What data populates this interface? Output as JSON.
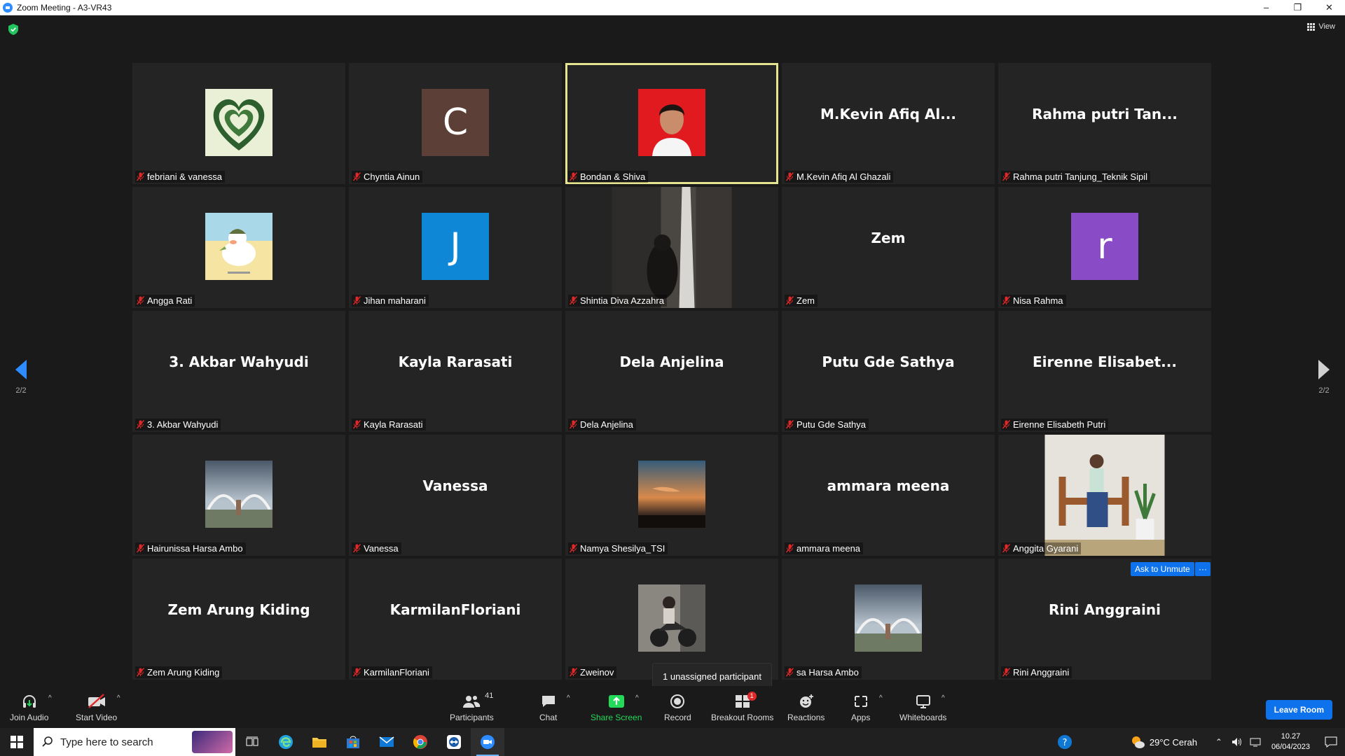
{
  "window": {
    "title": "Zoom Meeting - A3-VR43",
    "minimize": "–",
    "restore": "❐",
    "close": "✕"
  },
  "view_label": "View",
  "pagination": {
    "left": "2/2",
    "right": "2/2"
  },
  "tiles": [
    {
      "name": "febriani & vanessa",
      "kind": "image",
      "image": "green-heart"
    },
    {
      "name": "Chyntia Ainun",
      "kind": "letter",
      "letter": "C",
      "color": "#5c3f36"
    },
    {
      "name": "Bondan & Shiva",
      "kind": "image",
      "image": "portrait-red",
      "active": true
    },
    {
      "name": "M.Kevin Afiq Al Ghazali",
      "kind": "text",
      "display": "M.Kevin  Afiq  Al..."
    },
    {
      "name": "Rahma putri Tanjung_Teknik Sipil",
      "kind": "text",
      "display": "Rahma  putri  Tan..."
    },
    {
      "name": "Angga Rati",
      "kind": "image",
      "image": "duck-sticker"
    },
    {
      "name": "Jihan maharani",
      "kind": "letter",
      "letter": "J",
      "color": "#0e87d6"
    },
    {
      "name": "Shintia Diva Azzahra",
      "kind": "photo-tall",
      "image": "waterfall"
    },
    {
      "name": "Zem",
      "kind": "text",
      "display": "Zem"
    },
    {
      "name": "Nisa Rahma",
      "kind": "letter",
      "letter": "r",
      "color": "#8a4bc7"
    },
    {
      "name": "3. Akbar Wahyudi",
      "kind": "text",
      "display": "3. Akbar Wahyudi"
    },
    {
      "name": "Kayla Rarasati",
      "kind": "text",
      "display": "Kayla Rarasati"
    },
    {
      "name": "Dela Anjelina",
      "kind": "text",
      "display": "Dela Anjelina"
    },
    {
      "name": "Putu Gde Sathya",
      "kind": "text",
      "display": "Putu Gde Sathya"
    },
    {
      "name": "Eirenne Elisabeth Putri",
      "kind": "text",
      "display": "Eirenne  Elisabet..."
    },
    {
      "name": "Hairunissa Harsa Ambo",
      "kind": "image",
      "image": "sky-arches"
    },
    {
      "name": "Vanessa",
      "kind": "text",
      "display": "Vanessa"
    },
    {
      "name": "Namya Shesilya_TSI",
      "kind": "image",
      "image": "sunset"
    },
    {
      "name": "ammara meena",
      "kind": "text",
      "display": "ammara meena"
    },
    {
      "name": "Anggita Gyarani",
      "kind": "photo-tall",
      "image": "bench-portrait"
    },
    {
      "name": "Zem Arung Kiding",
      "kind": "text",
      "display": "Zem Arung Kiding"
    },
    {
      "name": "KarmilanFloriani",
      "kind": "text",
      "display": "KarmilanFloriani"
    },
    {
      "name": "Zweinov",
      "kind": "image",
      "image": "motorbike"
    },
    {
      "name": "Hairunissa Harsa Ambo",
      "kind": "image",
      "image": "sky-arches",
      "label_display": "sa Harsa Ambo"
    },
    {
      "name": "Rini Anggraini",
      "kind": "text",
      "display": "Rini Anggraini"
    }
  ],
  "ask_to_unmute": "Ask to Unmute",
  "more_label": "···",
  "tooltip": "1 unassigned participant",
  "toolbar": {
    "join_audio": "Join Audio",
    "start_video": "Start Video",
    "participants": "Participants",
    "participants_count": "41",
    "chat": "Chat",
    "share_screen": "Share Screen",
    "record": "Record",
    "breakout_rooms": "Breakout Rooms",
    "breakout_badge": "1",
    "reactions": "Reactions",
    "apps": "Apps",
    "whiteboards": "Whiteboards",
    "leave_room": "Leave Room"
  },
  "taskbar": {
    "search_placeholder": "Type here to search",
    "weather": "29°C  Cerah",
    "time": "10.27",
    "date": "06/04/2023"
  },
  "colors": {
    "accent": "#0e72ed",
    "active_speaker": "#e6e58f",
    "share_green": "#23d959",
    "muted_red": "#e02828"
  }
}
